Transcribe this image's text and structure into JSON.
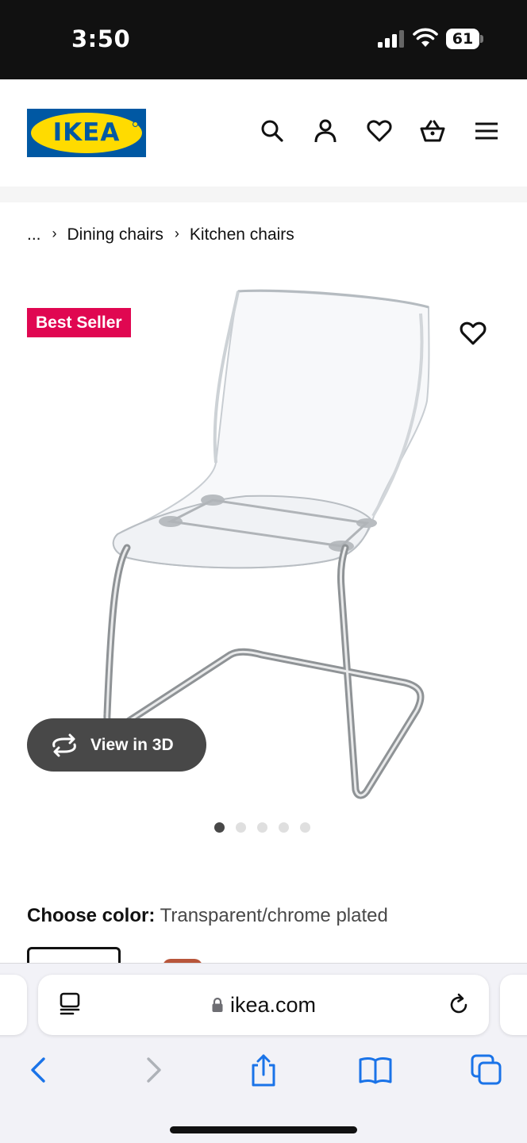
{
  "status_bar": {
    "time": "3:50",
    "battery": "61"
  },
  "header": {
    "logo_text": "IKEA",
    "icons": [
      "search-icon",
      "account-icon",
      "heart-icon",
      "basket-icon",
      "menu-icon"
    ]
  },
  "breadcrumb": {
    "items": [
      "...",
      "Dining chairs",
      "Kitchen chairs"
    ]
  },
  "product": {
    "badge": "Best Seller",
    "view3d_label": "View in 3D",
    "image_count": 5,
    "active_image": 1,
    "color_label": "Choose color:",
    "color_value": "Transparent/chrome plated"
  },
  "browser": {
    "url": "ikea.com"
  },
  "colors": {
    "ikea_blue": "#0058a3",
    "ikea_yellow": "#ffdb00",
    "badge_red": "#e00751",
    "safari_blue": "#1a73e8"
  }
}
